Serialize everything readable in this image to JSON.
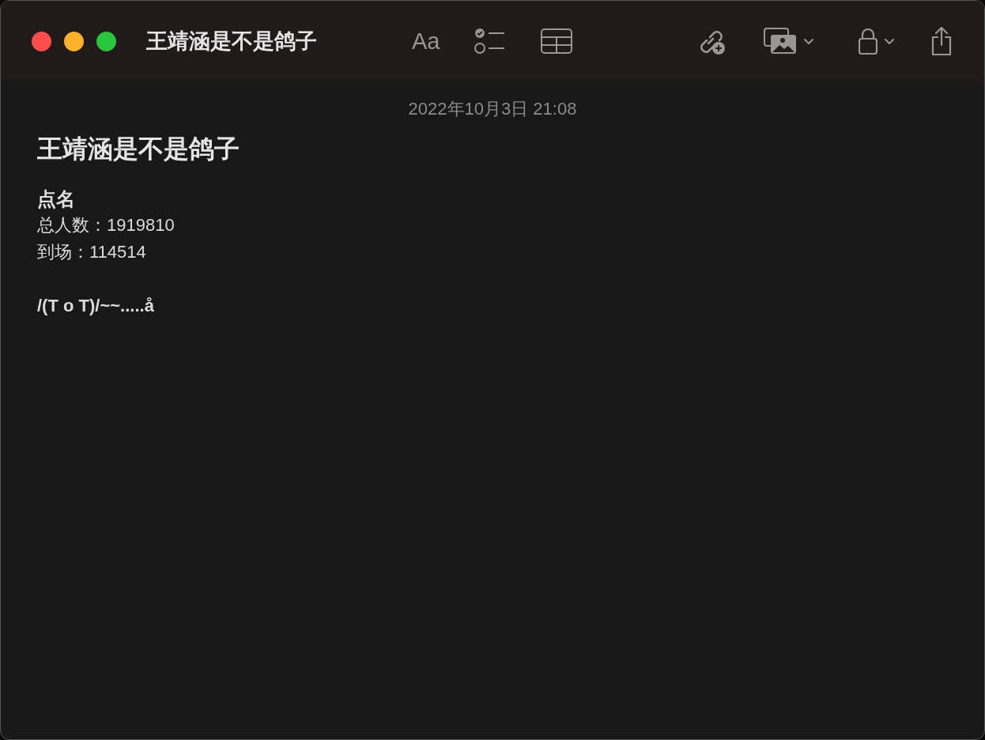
{
  "window": {
    "title": "王靖涵是不是鸽子"
  },
  "toolbar": {
    "format_label": "Aa"
  },
  "note": {
    "date": "2022年10月3日 21:08",
    "lines": [
      {
        "kind": "title",
        "text": "王靖涵是不是鸽子"
      },
      {
        "kind": "heading",
        "text": "点名"
      },
      {
        "kind": "body",
        "text": "总人数：1919810"
      },
      {
        "kind": "body",
        "text": "到场：114514"
      },
      {
        "kind": "blank"
      },
      {
        "kind": "bold",
        "text": "/(T o T)/~~.....å"
      }
    ]
  }
}
